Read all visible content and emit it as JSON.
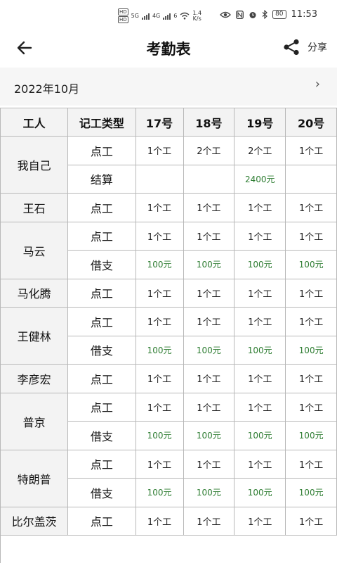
{
  "status_bar": {
    "sim1": "HD",
    "sim2": "HD",
    "net1": "5G",
    "net2": "4G",
    "wifi": "6",
    "speed_value": "1.4",
    "speed_unit": "K/s",
    "battery": "80",
    "time": "11:53"
  },
  "header": {
    "title": "考勤表",
    "share_label": "分享"
  },
  "month_bar": {
    "month": "2022年10月",
    "next": "›"
  },
  "table": {
    "headers": [
      "工人",
      "记工类型",
      "17号",
      "18号",
      "19号",
      "20号"
    ],
    "rows": [
      {
        "worker": "我自己",
        "type": "点工",
        "d17": "1个工",
        "d18": "2个工",
        "d19": "2个工",
        "d20": "1个工"
      },
      {
        "worker": "",
        "type": "结算",
        "d17": "",
        "d18": "",
        "d19": "2400元",
        "d20": ""
      },
      {
        "worker": "王石",
        "type": "点工",
        "d17": "1个工",
        "d18": "1个工",
        "d19": "1个工",
        "d20": "1个工"
      },
      {
        "worker": "马云",
        "type": "点工",
        "d17": "1个工",
        "d18": "1个工",
        "d19": "1个工",
        "d20": "1个工"
      },
      {
        "worker": "",
        "type": "借支",
        "d17": "100元",
        "d18": "100元",
        "d19": "100元",
        "d20": "100元"
      },
      {
        "worker": "马化腾",
        "type": "点工",
        "d17": "1个工",
        "d18": "1个工",
        "d19": "1个工",
        "d20": "1个工"
      },
      {
        "worker": "王健林",
        "type": "点工",
        "d17": "1个工",
        "d18": "1个工",
        "d19": "1个工",
        "d20": "1个工"
      },
      {
        "worker": "",
        "type": "借支",
        "d17": "100元",
        "d18": "100元",
        "d19": "100元",
        "d20": "100元"
      },
      {
        "worker": "李彦宏",
        "type": "点工",
        "d17": "1个工",
        "d18": "1个工",
        "d19": "1个工",
        "d20": "1个工"
      },
      {
        "worker": "普京",
        "type": "点工",
        "d17": "1个工",
        "d18": "1个工",
        "d19": "1个工",
        "d20": "1个工"
      },
      {
        "worker": "",
        "type": "借支",
        "d17": "100元",
        "d18": "100元",
        "d19": "100元",
        "d20": "100元"
      },
      {
        "worker": "特朗普",
        "type": "点工",
        "d17": "1个工",
        "d18": "1个工",
        "d19": "1个工",
        "d20": "1个工"
      },
      {
        "worker": "",
        "type": "借支",
        "d17": "100元",
        "d18": "100元",
        "d19": "100元",
        "d20": "100元"
      },
      {
        "worker": "比尔盖茨",
        "type": "点工",
        "d17": "1个工",
        "d18": "1个工",
        "d19": "1个工",
        "d20": "1个工"
      }
    ]
  },
  "colors": {
    "money": "#2e7d32",
    "header_bg": "#f3f3f3",
    "border": "#b8b8b8"
  }
}
